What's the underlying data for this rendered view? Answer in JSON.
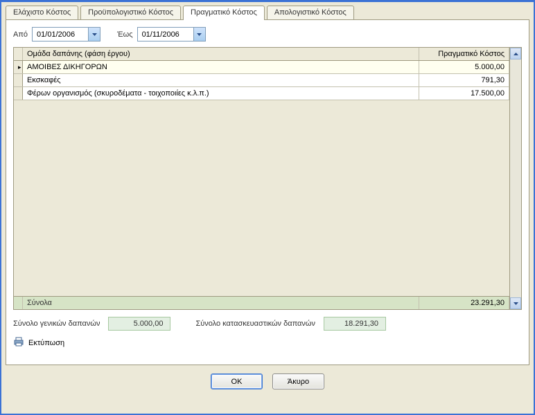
{
  "tabs": [
    {
      "label": "Ελάχιστο Κόστος"
    },
    {
      "label": "Προϋπολογιστικό Κόστος"
    },
    {
      "label": "Πραγματικό Κόστος"
    },
    {
      "label": "Απολογιστικό Κόστος"
    }
  ],
  "dateFrom": {
    "label": "Από",
    "value": "01/01/2006"
  },
  "dateTo": {
    "label": "Έως",
    "value": "01/11/2006"
  },
  "grid": {
    "headers": {
      "group": "Ομάδα δαπάνης (φάση έργου)",
      "cost": "Πραγματικό Κόστος"
    },
    "rows": [
      {
        "group": "ΑΜΟΙΒΕΣ ΔΙΚΗΓΟΡΩΝ",
        "cost": "5.000,00"
      },
      {
        "group": "Εκσκαφές",
        "cost": "791,30"
      },
      {
        "group": "Φέρων οργανισμός (σκυροδέματα - τοιχοποιίες κ.λ.π.)",
        "cost": "17.500,00"
      }
    ],
    "totals": {
      "label": "Σύνολα",
      "value": "23.291,30"
    }
  },
  "summary": {
    "general": {
      "label": "Σύνολο γενικών δαπανών",
      "value": "5.000,00"
    },
    "construction": {
      "label": "Σύνολο κατασκευαστικών δαπανών",
      "value": "18.291,30"
    }
  },
  "print": {
    "label": "Εκτύπωση"
  },
  "buttons": {
    "ok": "OK",
    "cancel": "Άκυρο"
  }
}
